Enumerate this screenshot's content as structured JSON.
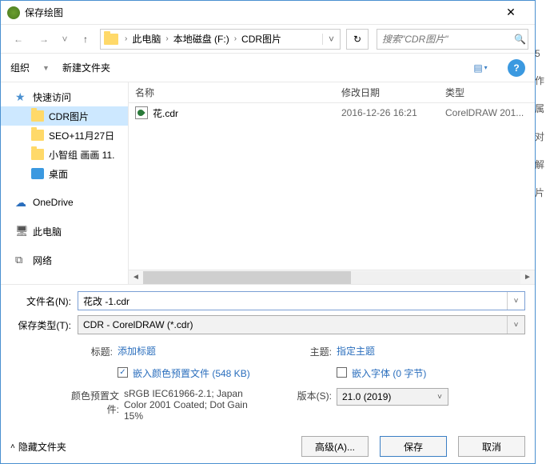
{
  "title": "保存绘图",
  "breadcrumb": {
    "items": [
      "此电脑",
      "本地磁盘 (F:)",
      "CDR图片"
    ]
  },
  "search": {
    "placeholder": "搜索\"CDR图片\""
  },
  "toolbar": {
    "organize": "组织",
    "newfolder": "新建文件夹"
  },
  "sidebar": {
    "quick": "快速访问",
    "items": [
      "CDR图片",
      "SEO+11月27日",
      "小智组 画画 11."
    ],
    "desktop": "桌面",
    "onedrive": "OneDrive",
    "pc": "此电脑",
    "network": "网络"
  },
  "columns": {
    "name": "名称",
    "date": "修改日期",
    "type": "类型"
  },
  "files": [
    {
      "name": "花.cdr",
      "date": "2016-12-26 16:21",
      "type": "CorelDRAW 201..."
    }
  ],
  "filename_label": "文件名(N):",
  "filename_value": "花改 -1.cdr",
  "filetype_label": "保存类型(T):",
  "filetype_value": "CDR - CorelDRAW (*.cdr)",
  "opts": {
    "title_label": "标题:",
    "title_link": "添加标题",
    "subject_label": "主题:",
    "subject_link": "指定主题",
    "embed_profile": "嵌入颜色预置文件 (548 KB)",
    "profile_label": "颜色预置文件:",
    "profile_value": "sRGB IEC61966-2.1; Japan Color 2001 Coated; Dot Gain 15%",
    "embed_font": "嵌入字体 (0 字节)",
    "version_label": "版本(S):",
    "version_value": "21.0 (2019)"
  },
  "footer": {
    "hide": "隐藏文件夹",
    "advanced": "高级(A)...",
    "save": "保存",
    "cancel": "取消"
  },
  "right_strip": [
    "5",
    "作",
    "属",
    "对",
    "解",
    "片"
  ]
}
